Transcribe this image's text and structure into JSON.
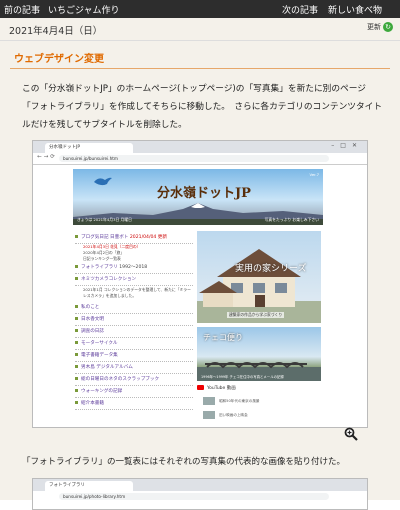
{
  "topnav": {
    "prev": "前の記事",
    "ichigo": "いちごジャム作り",
    "next": "次の記事",
    "newfood": "新しい食べ物"
  },
  "header": {
    "date": "2021年4月4日（日）",
    "update_label": "更新"
  },
  "article": {
    "title": "ウェブデザイン変更",
    "paragraph1": "この「分水嶺ドットJP」のホームページ(トップページ)の「写真集」を新たに別のページ「フォトライブラリ」を作成してそちらに移動した。　さらに各カテゴリのコンテンツタイトルだけを残してサブタイトルを削除した。",
    "paragraph2": "「フォトライブラリ」の一覧表にはそれぞれの写真集の代表的な画像を貼り付けた。"
  },
  "screenshot1": {
    "tab_title": "分水嶺ドットJP",
    "url": "bunsuirei.jp/bunsuirei.htm",
    "banner_title": "分水嶺ドットJP",
    "banner_date": "きょうは 2021年4月3日 月曜日",
    "banner_right": "写真をたっぷり お楽しみ下さい",
    "banner_label": "Ver.7",
    "menu": [
      {
        "label": "ブログ気日記 日豊ボト",
        "date": "2021/04/04 更新"
      },
      {
        "label": "フォトライブラリ",
        "date": "1992～2018"
      },
      {
        "label": "ネミツカメラコレクション",
        "date": ""
      },
      {
        "label": "私のこと",
        "date": ""
      },
      {
        "label": "日水香文明",
        "date": ""
      },
      {
        "label": "調査の日誌",
        "date": ""
      },
      {
        "label": "モーターサイクル",
        "date": ""
      },
      {
        "label": "電子書籍データ集",
        "date": ""
      },
      {
        "label": "男木島 デジタルアルバム",
        "date": ""
      },
      {
        "label": "総の日曜日のネタのスクラップブック",
        "date": ""
      },
      {
        "label": "ウォーキングの記録",
        "date": ""
      },
      {
        "label": "紹介本書籍",
        "date": ""
      }
    ],
    "blog_subs": [
      "2021年4月3日 花見（二度目の）",
      "2020年4月2日の「旅」",
      "日記ランキング一覧表"
    ],
    "camera_sub": "2021年1月 コレクションのデータを整理して、新たに「ミラーレスカメラ」を追加しました。",
    "house_title": "実用の家シリーズ",
    "house_caption": "建築家の作品から学ぶ家づくり",
    "czech_title": "チェコ便り",
    "czech_caption": "1996年～1999年 チェコ在住中の写真とメールの記録",
    "youtube_label": "YouTube 動画",
    "yt_items": [
      "昭和50年代の東京の風景",
      "旧い映画の上映会"
    ]
  },
  "screenshot2": {
    "tab_title": "フォトライブラリ",
    "url": "bunsuirei.jp/photo-library.htm"
  }
}
